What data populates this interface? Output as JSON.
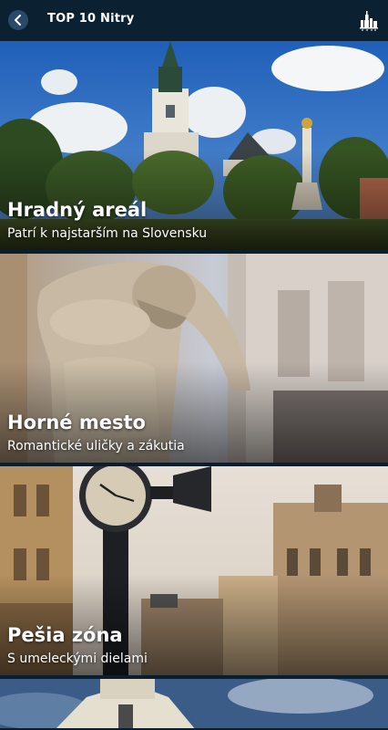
{
  "header": {
    "title": "TOP 10 Nitry",
    "back_icon": "chevron-left-icon",
    "menu_icon": "city-skyline-icon"
  },
  "cards": [
    {
      "name": "Hradný areál",
      "subtitle": "Patrí k najstarším na Slovensku"
    },
    {
      "name": "Horné mesto",
      "subtitle": "Romantické uličky a zákutia"
    },
    {
      "name": "Pešia zóna",
      "subtitle": "S umeleckými dielami"
    },
    {
      "name": "",
      "subtitle": ""
    }
  ],
  "colors": {
    "header_bg": "#0b2030",
    "back_button_bg": "#2b4a6a"
  }
}
